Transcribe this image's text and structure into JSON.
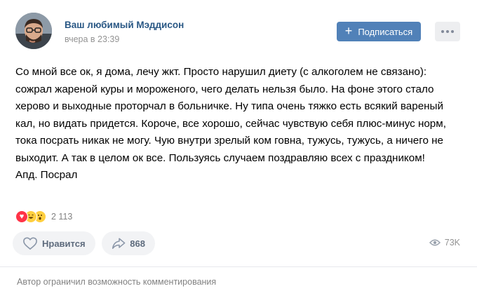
{
  "post": {
    "author_name": "Ваш любимый Мэддисон",
    "time": "вчера в 23:39",
    "subscribe_label": "Подписаться",
    "text": "Со мной все ок, я дома, лечу жкт. Просто нарушил диету (с алкоголем не связано): сожрал жареной куры и мороженого, чего делать нельзя было. На фоне этого стало херово и выходные проторчал в больничке. Ну типа очень тяжко есть всякий вареный кал, но видать придется. Короче, все хорошо, сейчас чувствую себя плюс-минус норм, тока посрать никак не могу. Чую внутри зрелый ком говна, тужусь, тужусь, а ничего не выходит. А так в целом ок все. Пользуясь случаем поздравляю всех с праздником!\nАпд. Посрал",
    "reactions": {
      "icons": [
        "heart-icon",
        "laughing-face-icon",
        "surprised-face-icon"
      ],
      "count": "2 113"
    },
    "like_label": "Нравится",
    "share_count": "868",
    "views": "73K",
    "comments_note": "Автор ограничил возможность комментирования"
  },
  "colors": {
    "link": "#2a5885",
    "button": "#5181b8",
    "secondary_text": "#939393",
    "action_bg": "#f2f3f5"
  }
}
